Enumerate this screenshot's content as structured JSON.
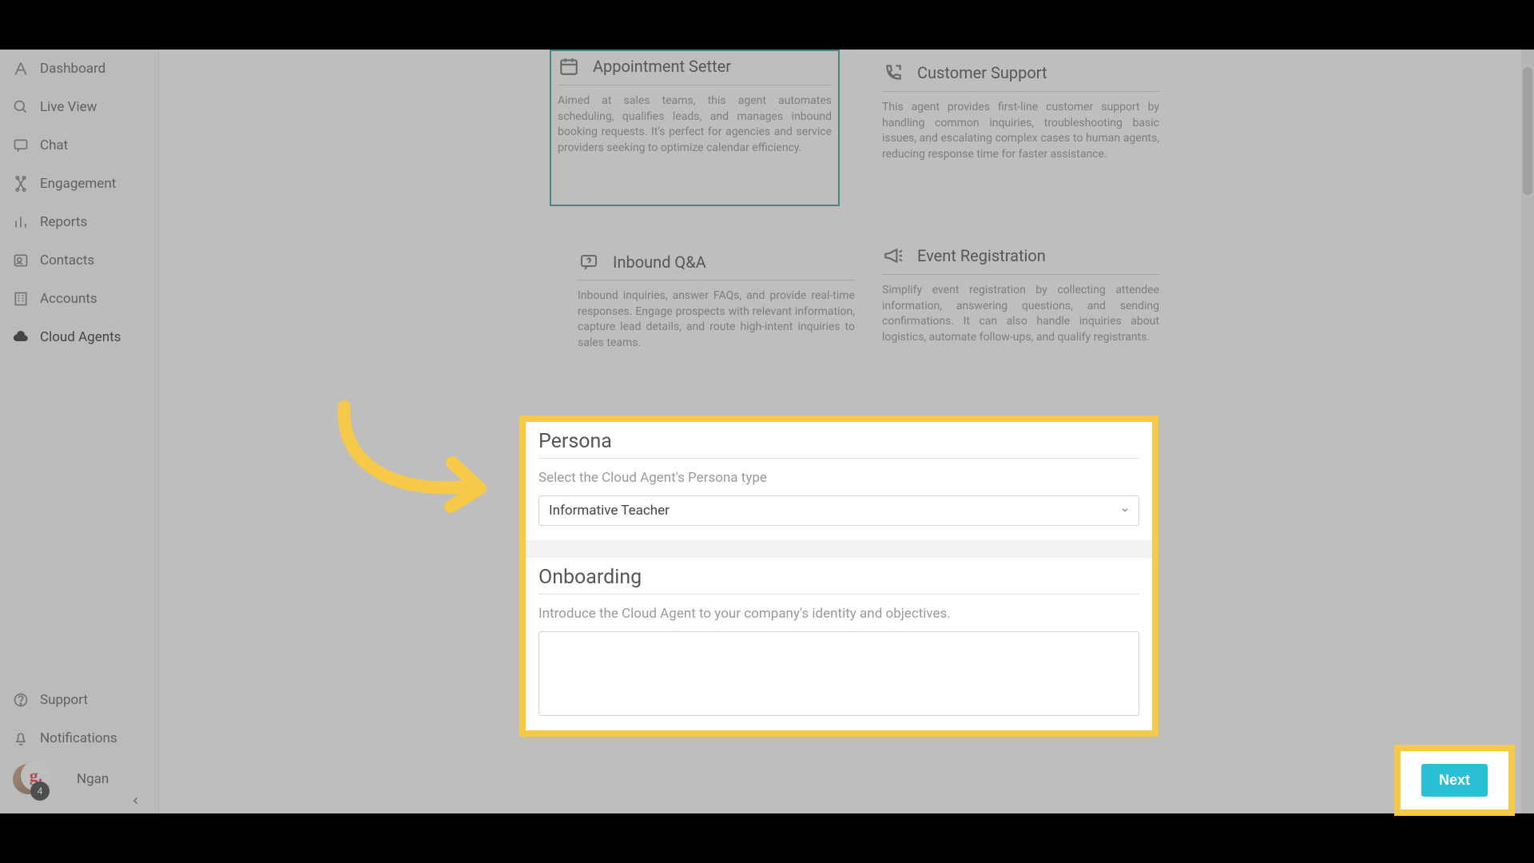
{
  "sidebar": {
    "items": [
      {
        "label": "Dashboard"
      },
      {
        "label": "Live View"
      },
      {
        "label": "Chat"
      },
      {
        "label": "Engagement"
      },
      {
        "label": "Reports"
      },
      {
        "label": "Contacts"
      },
      {
        "label": "Accounts"
      },
      {
        "label": "Cloud Agents"
      }
    ],
    "bottom": {
      "support": "Support",
      "notifications": "Notifications"
    },
    "user": {
      "name": "Ngan",
      "avatar_overlay": "g.",
      "badge": "4"
    }
  },
  "cards": {
    "appointment": {
      "title": "Appointment Setter",
      "body": "Aimed at sales teams, this agent automates scheduling, qualifies leads, and manages inbound booking requests. It's perfect for agencies and service providers seeking to optimize calendar efficiency."
    },
    "customer_support": {
      "title": "Customer Support",
      "body": "This agent provides first-line customer support by handling common inquiries, troubleshooting basic issues, and escalating complex cases to human agents, reducing response time for faster assistance."
    },
    "inbound_qa": {
      "title": "Inbound Q&A",
      "body": "Inbound inquiries, answer FAQs, and provide real-time responses. Engage prospects with relevant information, capture lead details, and route high-intent inquiries to sales teams."
    },
    "event_reg": {
      "title": "Event Registration",
      "body": "Simplify event registration by collecting attendee information, answering questions, and sending confirmations. It can also handle inquiries about logistics, automate follow-ups, and qualify registrants."
    }
  },
  "persona": {
    "title": "Persona",
    "sub": "Select the Cloud Agent's Persona type",
    "selected": "Informative Teacher"
  },
  "onboarding": {
    "title": "Onboarding",
    "sub": "Introduce the Cloud Agent to your company's identity and objectives.",
    "value": ""
  },
  "footer": {
    "next": "Next"
  }
}
